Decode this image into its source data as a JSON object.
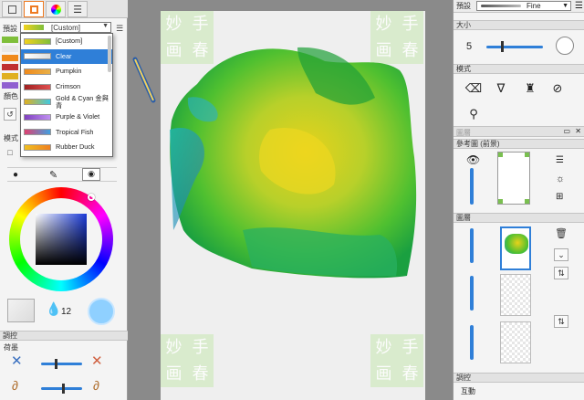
{
  "left_panel": {
    "preset_label": "預設",
    "dropdown_value": "[Custom]",
    "preset_options": [
      {
        "label": "[Custom]",
        "colors": [
          "#f2d21e",
          "#7fbf3a"
        ]
      },
      {
        "label": "Clear",
        "colors": [
          "#ffffff",
          "#dddddd"
        ]
      },
      {
        "label": "Pumpkin",
        "colors": [
          "#f08a1c",
          "#e8b048"
        ]
      },
      {
        "label": "Crimson",
        "colors": [
          "#a02020",
          "#e05050"
        ]
      },
      {
        "label": "Gold & Cyan 金與青",
        "colors": [
          "#e0b020",
          "#40c8e0"
        ]
      },
      {
        "label": "Purple & Violet",
        "colors": [
          "#8040c0",
          "#c090f0"
        ]
      },
      {
        "label": "Tropical Fish",
        "colors": [
          "#e04070",
          "#40a0e0"
        ]
      },
      {
        "label": "Rubber Duck",
        "colors": [
          "#f0c020",
          "#f08020"
        ]
      }
    ],
    "selected_preset_index": 1,
    "color_section_label": "顏色",
    "mode_label": "模式",
    "opacity_value": "12",
    "adjust_section_label": "調控",
    "blend_label": "荷墨"
  },
  "toolbar_right": {
    "preset_label": "預設",
    "brush_name": "Fine",
    "size_label": "大小",
    "size_value": "5",
    "mode_label": "模式",
    "ref_layer_label": "參考圖 (前景)",
    "layers_label": "圖層",
    "adjust_label": "調控",
    "interact_label": "互動",
    "panel_title": "圖層"
  },
  "canvas": {
    "stamp_chars": [
      "妙",
      "手",
      "画",
      "春"
    ]
  },
  "colors": {
    "accent": "#2f7fd8",
    "highlight_orange": "#ee7a22",
    "current_color": "#8fd0ff"
  }
}
